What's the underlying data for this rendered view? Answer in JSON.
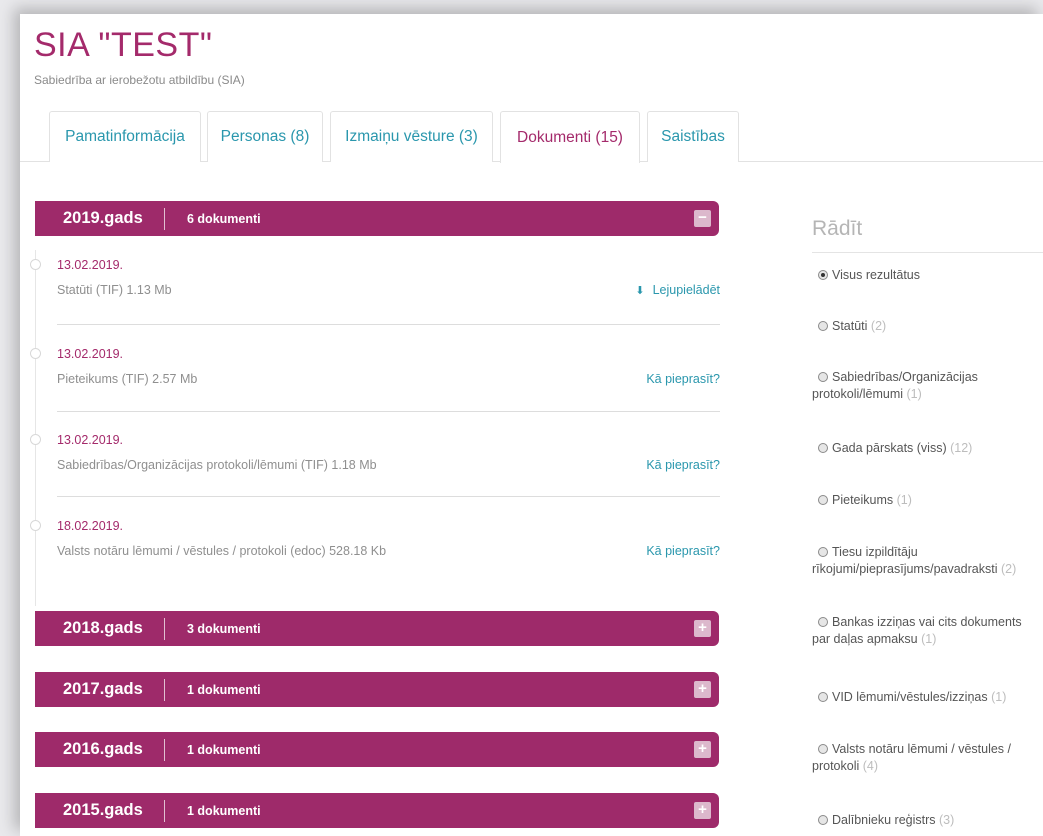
{
  "company": {
    "name": "SIA \"TEST\"",
    "type": "Sabiedrība ar ierobežotu atbildību (SIA)"
  },
  "tabs": [
    {
      "label": "Pamatinformācija",
      "active": false
    },
    {
      "label": "Personas (8)",
      "active": false
    },
    {
      "label": "Izmaiņu vēsture (3)",
      "active": false
    },
    {
      "label": "Dokumenti (15)",
      "active": true
    },
    {
      "label": "Saistības",
      "active": false
    }
  ],
  "years": [
    {
      "label": "2019.gads",
      "count": "6 dokumenti",
      "toggle": "−",
      "expanded": true
    },
    {
      "label": "2018.gads",
      "count": "3 dokumenti",
      "toggle": "+",
      "expanded": false
    },
    {
      "label": "2017.gads",
      "count": "1 dokumenti",
      "toggle": "+",
      "expanded": false
    },
    {
      "label": "2016.gads",
      "count": "1 dokumenti",
      "toggle": "+",
      "expanded": false
    },
    {
      "label": "2015.gads",
      "count": "1 dokumenti",
      "toggle": "+",
      "expanded": false
    }
  ],
  "documents": [
    {
      "date": "13.02.2019.",
      "name": "Statūti (TIF) 1.13 Mb",
      "action": "Lejupielādēt",
      "action_icon": "download-icon"
    },
    {
      "date": "13.02.2019.",
      "name": "Pieteikums (TIF) 2.57 Mb",
      "action": "Kā pieprasīt?"
    },
    {
      "date": "13.02.2019.",
      "name": "Sabiedrības/Organizācijas protokoli/lēmumi (TIF) 1.18 Mb",
      "action": "Kā pieprasīt?"
    },
    {
      "date": "18.02.2019.",
      "name": "Valsts notāru lēmumi / vēstules / protokoli (edoc) 528.18 Kb",
      "action": "Kā pieprasīt?"
    }
  ],
  "filter": {
    "title": "Rādīt",
    "options": [
      {
        "label": "Visus rezultātus",
        "count": "",
        "checked": true
      },
      {
        "label": "Statūti",
        "count": "(2)",
        "checked": false
      },
      {
        "label": "Sabiedrības/Organizācijas protokoli/lēmumi",
        "count": "(1)",
        "checked": false
      },
      {
        "label": "Gada pārskats (viss)",
        "count": "(12)",
        "checked": false
      },
      {
        "label": "Pieteikums",
        "count": "(1)",
        "checked": false
      },
      {
        "label": "Tiesu izpildītāju rīkojumi/pieprasījums/pavadraksti",
        "count": "(2)",
        "checked": false
      },
      {
        "label": "Bankas izziņas vai cits dokuments par daļas apmaksu",
        "count": "(1)",
        "checked": false
      },
      {
        "label": "VID lēmumi/vēstules/izziņas",
        "count": "(1)",
        "checked": false
      },
      {
        "label": "Valsts notāru lēmumi / vēstules / protokoli",
        "count": "(4)",
        "checked": false
      },
      {
        "label": "Dalībnieku reģistrs",
        "count": "(3)",
        "checked": false
      }
    ]
  },
  "colors": {
    "brand": "#a42a6b",
    "year_bar": "#9e2a6a",
    "link": "#2a97ad"
  }
}
